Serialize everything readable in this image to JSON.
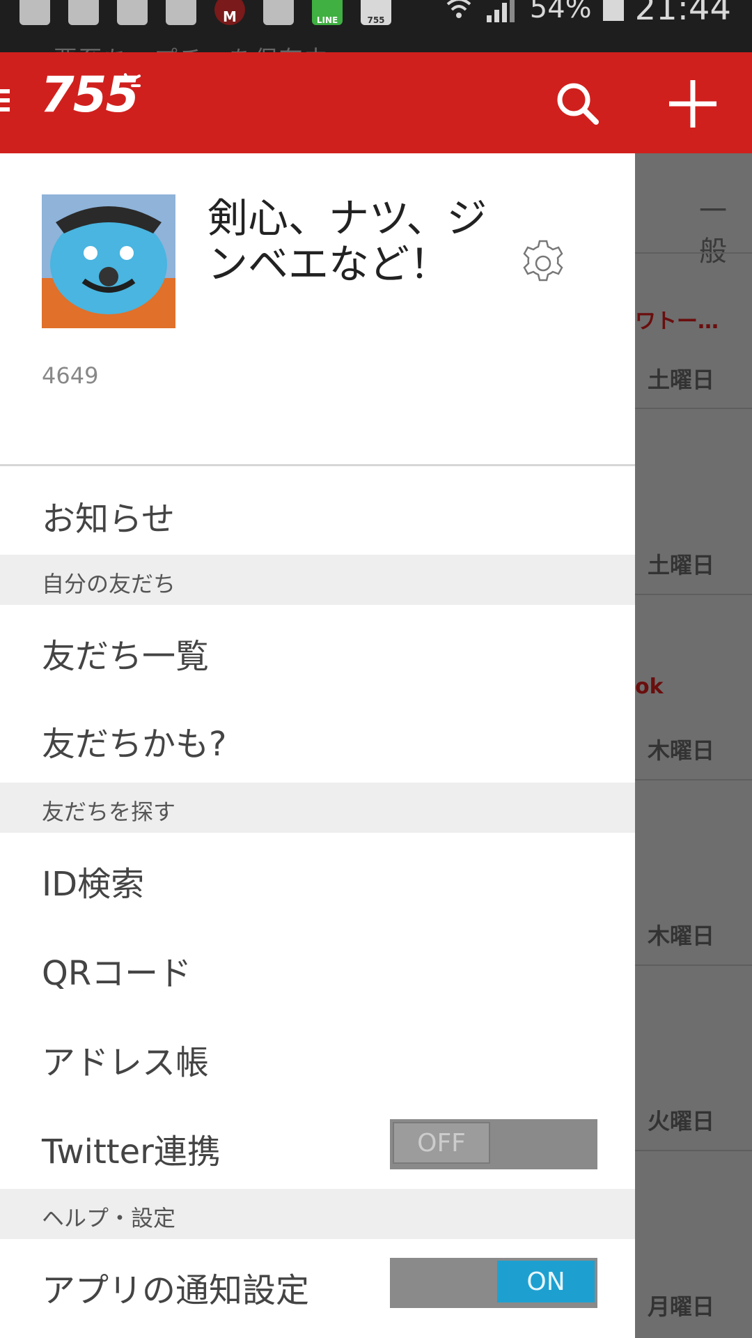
{
  "status_bar": {
    "battery": "54%",
    "time": "21:44",
    "line_icon_label": "LINE",
    "app_icon_label": "755",
    "notification_ghost": "□ 要至ちゃプチャを保存中"
  },
  "header": {
    "logo": "755",
    "brand_color": "#d0201d"
  },
  "background_content": {
    "tab_label": "一般",
    "red_text_1": "ワトー…",
    "red_text_2": "ok",
    "days": [
      "土曜日",
      "土曜日",
      "木曜日",
      "木曜日",
      "火曜日",
      "月曜日"
    ]
  },
  "drawer": {
    "profile": {
      "name": "剣心、ナツ、ジンベエなど！",
      "id": "4649"
    },
    "notifications_label": "お知らせ",
    "sections": {
      "my_friends": "自分の友だち",
      "find_friends": "友だちを探す",
      "help_settings": "ヘルプ・設定"
    },
    "items": {
      "friend_list": "友だち一覧",
      "maybe_friends": "友だちかも?",
      "id_search": "ID検索",
      "qr_code": "QRコード",
      "address_book": "アドレス帳",
      "twitter": "Twitter連携",
      "notification_settings": "アプリの通知設定"
    },
    "toggles": {
      "twitter": {
        "state": "OFF"
      },
      "app_notifications": {
        "state": "ON",
        "color": "#1da0d0"
      }
    }
  }
}
